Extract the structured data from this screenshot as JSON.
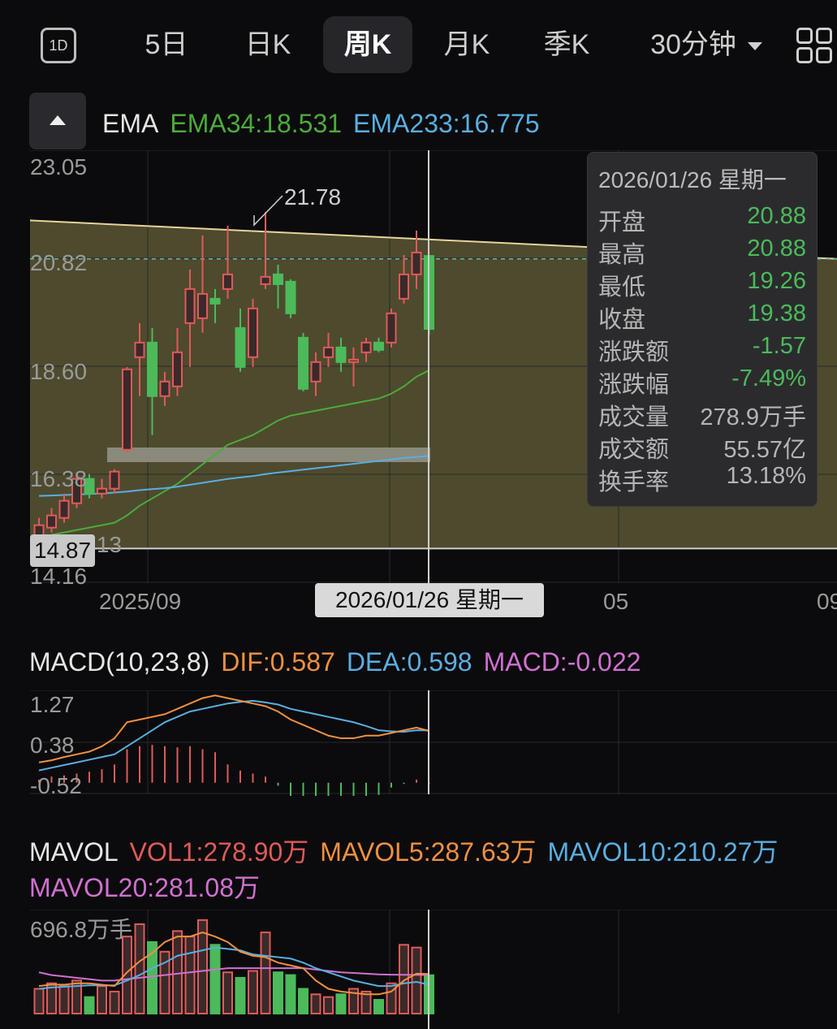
{
  "period_tabs": {
    "day_icon": "1D",
    "items": [
      "5日",
      "日K",
      "周K",
      "月K",
      "季K"
    ],
    "active": "周K",
    "interval": "30分钟",
    "grid_icon": "grid-icon"
  },
  "main_indicator": {
    "name": "EMA",
    "ema34": "EMA34:18.531",
    "ema233": "EMA233:16.775",
    "colors": {
      "ema34": "#4caa3c",
      "ema233": "#5aaee0"
    }
  },
  "price_axis": {
    "top": "23.05",
    "mid1": "20.82",
    "mid2": "18.60",
    "low1": "16.38",
    "bottom": "14.16"
  },
  "annotations": {
    "high_label": "21.78",
    "low_label": "14.13",
    "current_price_badge": "14.87"
  },
  "time_axis": [
    "2025/09",
    "05",
    "09"
  ],
  "cursor_date": "2026/01/26 星期一",
  "tooltip": {
    "date": "2026/01/26 星期一",
    "rows": [
      {
        "k": "开盘",
        "v": "20.88",
        "green": true
      },
      {
        "k": "最高",
        "v": "20.88",
        "green": true
      },
      {
        "k": "最低",
        "v": "19.26",
        "green": true
      },
      {
        "k": "收盘",
        "v": "19.38",
        "green": true
      },
      {
        "k": "涨跌额",
        "v": "-1.57",
        "green": true
      },
      {
        "k": "涨跌幅",
        "v": "-7.49%",
        "green": true
      },
      {
        "k": "成交量",
        "v": "278.9万手",
        "green": false
      },
      {
        "k": "成交额",
        "v": "55.57亿",
        "green": false
      },
      {
        "k": "换手率",
        "v": "13.18%",
        "green": false
      }
    ]
  },
  "macd": {
    "title": "MACD(10,23,8)",
    "dif": "DIF:0.587",
    "dea": "DEA:0.598",
    "macd": "MACD:-0.022",
    "axis": [
      "1.27",
      "0.38",
      "-0.52"
    ],
    "colors": {
      "dif": "#f09040",
      "dea": "#5aaee0",
      "macd": "#d070d0"
    }
  },
  "mavol": {
    "title": "MAVOL",
    "vol1": "VOL1:278.90万",
    "mavol5": "MAVOL5:287.63万",
    "mavol10": "MAVOL10:210.27万",
    "mavol20": "MAVOL20:281.08万",
    "axis_top": "696.8万手",
    "colors": {
      "vol1": "#e05a5a",
      "mavol5": "#f09040",
      "mavol10": "#5aaee0",
      "mavol20": "#d070d0"
    }
  },
  "chart_data": {
    "type": "candlestick",
    "ylim": [
      14.16,
      23.05
    ],
    "candles": [
      {
        "o": 15.1,
        "c": 15.35,
        "h": 15.5,
        "l": 14.9
      },
      {
        "o": 15.3,
        "c": 15.55,
        "h": 15.7,
        "l": 15.2
      },
      {
        "o": 15.5,
        "c": 15.85,
        "h": 16.0,
        "l": 15.4
      },
      {
        "o": 15.8,
        "c": 16.3,
        "h": 16.4,
        "l": 15.7
      },
      {
        "o": 16.3,
        "c": 16.0,
        "h": 16.4,
        "l": 15.9
      },
      {
        "o": 16.0,
        "c": 16.1,
        "h": 16.3,
        "l": 15.9
      },
      {
        "o": 16.1,
        "c": 16.45,
        "h": 16.5,
        "l": 16.0
      },
      {
        "o": 16.9,
        "c": 18.55,
        "h": 18.6,
        "l": 16.85
      },
      {
        "o": 18.8,
        "c": 19.1,
        "h": 19.5,
        "l": 18.0
      },
      {
        "o": 19.1,
        "c": 18.0,
        "h": 19.4,
        "l": 17.2
      },
      {
        "o": 18.0,
        "c": 18.3,
        "h": 18.5,
        "l": 17.8
      },
      {
        "o": 18.2,
        "c": 18.9,
        "h": 19.4,
        "l": 18.0
      },
      {
        "o": 19.5,
        "c": 20.2,
        "h": 20.6,
        "l": 18.6
      },
      {
        "o": 19.6,
        "c": 20.1,
        "h": 21.3,
        "l": 19.3
      },
      {
        "o": 20.0,
        "c": 19.9,
        "h": 20.2,
        "l": 19.5
      },
      {
        "o": 20.2,
        "c": 20.5,
        "h": 21.5,
        "l": 20.0
      },
      {
        "o": 19.4,
        "c": 18.6,
        "h": 19.8,
        "l": 18.5
      },
      {
        "o": 18.8,
        "c": 19.8,
        "h": 20.0,
        "l": 18.6
      },
      {
        "o": 20.3,
        "c": 20.45,
        "h": 21.78,
        "l": 20.2
      },
      {
        "o": 20.5,
        "c": 20.3,
        "h": 20.7,
        "l": 19.8
      },
      {
        "o": 20.35,
        "c": 19.7,
        "h": 20.4,
        "l": 19.6
      },
      {
        "o": 19.2,
        "c": 18.15,
        "h": 19.3,
        "l": 18.1
      },
      {
        "o": 18.3,
        "c": 18.7,
        "h": 18.9,
        "l": 18.0
      },
      {
        "o": 18.8,
        "c": 19.0,
        "h": 19.3,
        "l": 18.6
      },
      {
        "o": 19.0,
        "c": 18.7,
        "h": 19.2,
        "l": 18.5
      },
      {
        "o": 18.7,
        "c": 18.75,
        "h": 19.0,
        "l": 18.2
      },
      {
        "o": 18.9,
        "c": 19.1,
        "h": 19.2,
        "l": 18.7
      },
      {
        "o": 19.1,
        "c": 18.95,
        "h": 19.2,
        "l": 18.9
      },
      {
        "o": 19.1,
        "c": 19.7,
        "h": 19.8,
        "l": 19.0
      },
      {
        "o": 20.0,
        "c": 20.5,
        "h": 20.9,
        "l": 19.9
      },
      {
        "o": 20.5,
        "c": 20.95,
        "h": 21.4,
        "l": 20.2
      },
      {
        "o": 20.88,
        "c": 19.38,
        "h": 20.88,
        "l": 19.26
      }
    ],
    "ema34": [
      15.1,
      15.15,
      15.2,
      15.25,
      15.3,
      15.35,
      15.4,
      15.55,
      15.75,
      15.9,
      16.05,
      16.2,
      16.4,
      16.6,
      16.8,
      17.0,
      17.1,
      17.2,
      17.35,
      17.5,
      17.6,
      17.65,
      17.7,
      17.75,
      17.8,
      17.85,
      17.9,
      17.95,
      18.05,
      18.2,
      18.4,
      18.53
    ],
    "ema233": [
      15.95,
      15.96,
      15.97,
      15.98,
      15.99,
      16.0,
      16.02,
      16.04,
      16.07,
      16.09,
      16.11,
      16.14,
      16.18,
      16.22,
      16.26,
      16.3,
      16.33,
      16.36,
      16.4,
      16.43,
      16.46,
      16.49,
      16.52,
      16.55,
      16.58,
      16.61,
      16.64,
      16.67,
      16.7,
      16.73,
      16.75,
      16.775
    ],
    "trendline": [
      {
        "date_index": 0,
        "price": 21.6
      },
      {
        "date_index": 65,
        "price": 20.8
      }
    ],
    "dashed_price": 20.82,
    "horizontal_support": 14.87,
    "macd_series": {
      "dif": [
        0.0,
        0.04,
        0.1,
        0.15,
        0.2,
        0.3,
        0.45,
        0.75,
        0.8,
        0.85,
        0.9,
        1.0,
        1.1,
        1.2,
        1.25,
        1.2,
        1.15,
        1.1,
        1.05,
        0.95,
        0.8,
        0.7,
        0.6,
        0.5,
        0.45,
        0.45,
        0.5,
        0.5,
        0.55,
        0.6,
        0.65,
        0.587
      ],
      "dea": [
        -0.15,
        -0.1,
        -0.05,
        0.0,
        0.05,
        0.1,
        0.15,
        0.3,
        0.45,
        0.6,
        0.75,
        0.85,
        0.95,
        1.0,
        1.05,
        1.1,
        1.13,
        1.15,
        1.12,
        1.08,
        1.0,
        0.95,
        0.9,
        0.85,
        0.8,
        0.75,
        0.68,
        0.6,
        0.58,
        0.57,
        0.6,
        0.598
      ],
      "hist": [
        0.05,
        0.1,
        0.12,
        0.15,
        0.18,
        0.22,
        0.3,
        0.55,
        0.6,
        0.62,
        0.6,
        0.58,
        0.6,
        0.55,
        0.5,
        0.3,
        0.2,
        0.15,
        0.1,
        -0.05,
        -0.25,
        -0.3,
        -0.3,
        -0.32,
        -0.35,
        -0.3,
        -0.25,
        -0.2,
        -0.08,
        -0.02,
        0.05,
        -0.022
      ]
    },
    "volume": {
      "ylim": [
        0,
        696.8
      ],
      "vol": [
        180,
        220,
        200,
        240,
        120,
        200,
        160,
        560,
        650,
        520,
        450,
        600,
        560,
        680,
        500,
        300,
        260,
        310,
        590,
        300,
        280,
        180,
        140,
        120,
        140,
        180,
        160,
        100,
        220,
        500,
        480,
        278.9
      ],
      "mavol5": [
        200,
        210,
        210,
        220,
        220,
        210,
        200,
        300,
        380,
        440,
        520,
        560,
        560,
        590,
        560,
        520,
        450,
        420,
        410,
        370,
        350,
        330,
        240,
        180,
        160,
        150,
        140,
        140,
        160,
        240,
        290,
        287.63
      ],
      "mavol10": [
        180,
        190,
        195,
        200,
        205,
        205,
        205,
        240,
        280,
        330,
        370,
        420,
        440,
        460,
        480,
        470,
        460,
        430,
        420,
        410,
        400,
        370,
        330,
        300,
        270,
        240,
        220,
        200,
        200,
        220,
        230,
        210.27
      ],
      "mavol20": [
        300,
        280,
        270,
        260,
        250,
        240,
        240,
        250,
        260,
        270,
        280,
        290,
        300,
        310,
        320,
        330,
        330,
        330,
        330,
        330,
        330,
        330,
        320,
        310,
        300,
        295,
        290,
        285,
        283,
        282,
        281,
        281.08
      ]
    }
  }
}
